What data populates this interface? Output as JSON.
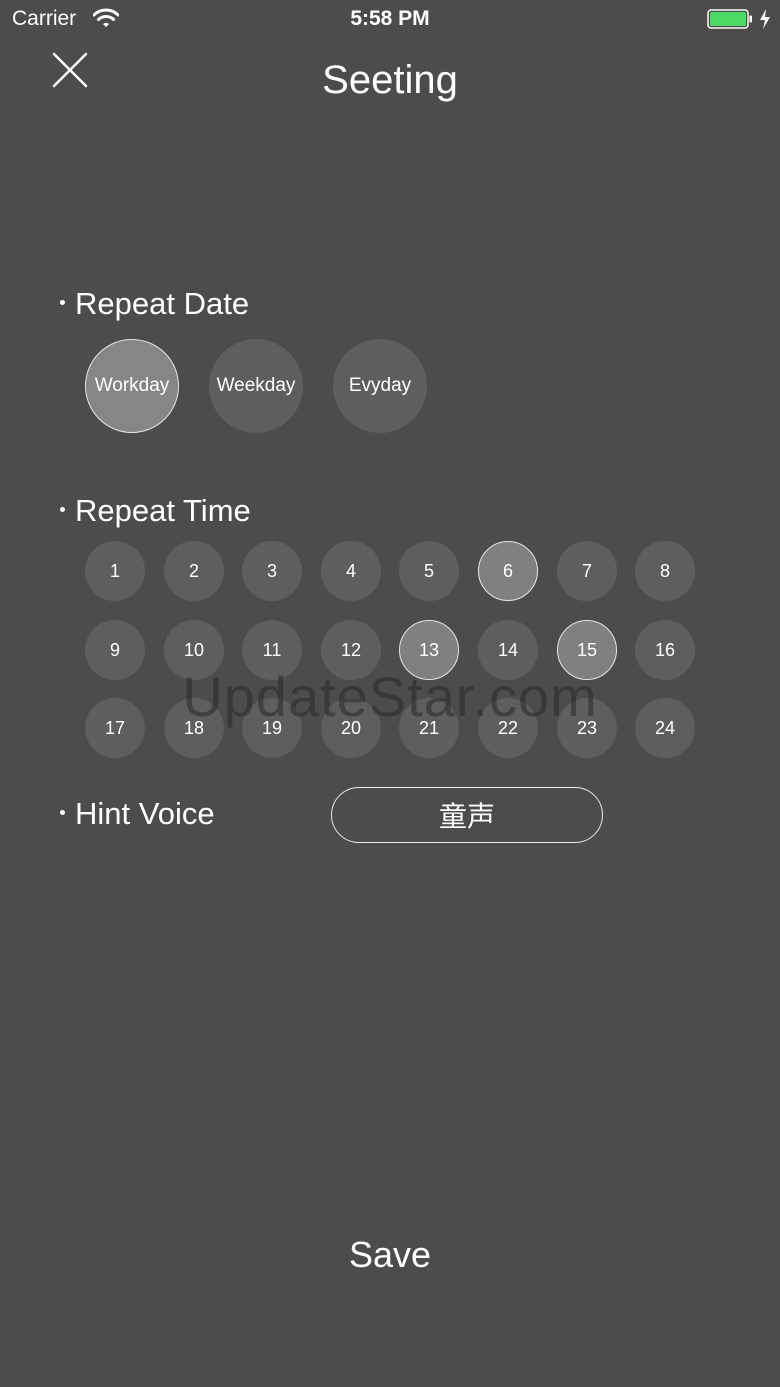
{
  "status_bar": {
    "carrier": "Carrier",
    "time": "5:58 PM",
    "battery_color": "#4cd964"
  },
  "header": {
    "close_icon": "close-icon",
    "title": "Seeting"
  },
  "repeat_date": {
    "label": "Repeat Date",
    "options": [
      {
        "label": "Workday",
        "selected": true
      },
      {
        "label": "Weekday",
        "selected": false
      },
      {
        "label": "Evyday",
        "selected": false
      }
    ]
  },
  "repeat_time": {
    "label": "Repeat Time",
    "hours": [
      {
        "label": "1",
        "selected": false
      },
      {
        "label": "2",
        "selected": false
      },
      {
        "label": "3",
        "selected": false
      },
      {
        "label": "4",
        "selected": false
      },
      {
        "label": "5",
        "selected": false
      },
      {
        "label": "6",
        "selected": true
      },
      {
        "label": "7",
        "selected": false
      },
      {
        "label": "8",
        "selected": false
      },
      {
        "label": "9",
        "selected": false
      },
      {
        "label": "10",
        "selected": false
      },
      {
        "label": "11",
        "selected": false
      },
      {
        "label": "12",
        "selected": false
      },
      {
        "label": "13",
        "selected": true
      },
      {
        "label": "14",
        "selected": false
      },
      {
        "label": "15",
        "selected": true
      },
      {
        "label": "16",
        "selected": false
      },
      {
        "label": "17",
        "selected": false
      },
      {
        "label": "18",
        "selected": false
      },
      {
        "label": "19",
        "selected": false
      },
      {
        "label": "20",
        "selected": false
      },
      {
        "label": "21",
        "selected": false
      },
      {
        "label": "22",
        "selected": false
      },
      {
        "label": "23",
        "selected": false
      },
      {
        "label": "24",
        "selected": false
      }
    ]
  },
  "hint_voice": {
    "label": "Hint Voice",
    "value": "童声"
  },
  "watermark": "UpdateStar.com",
  "save_label": "Save"
}
